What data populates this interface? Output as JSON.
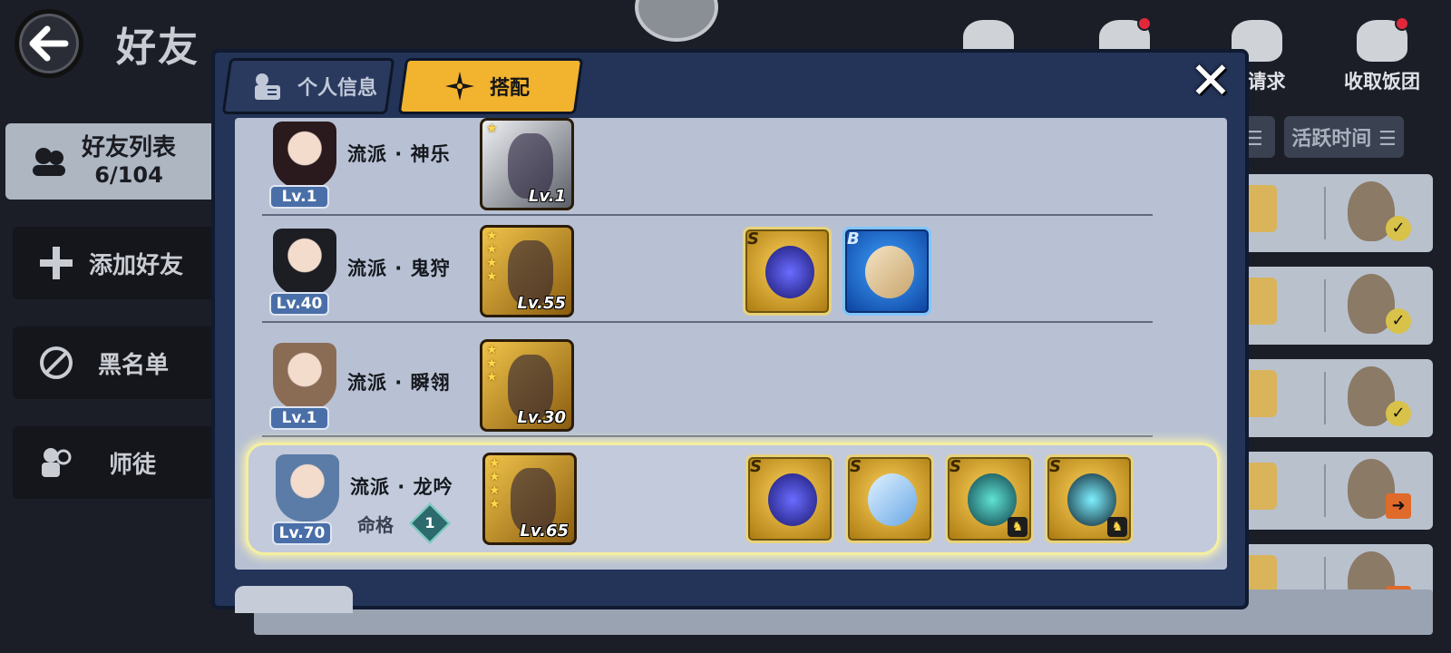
{
  "page": {
    "title": "好友",
    "back_icon": "back-arrow-icon"
  },
  "top_icons": [
    {
      "label": "",
      "icon": "group-icon",
      "has_dot": false
    },
    {
      "label": "",
      "icon": "friend-request-icon",
      "has_dot": true
    },
    {
      "label": "友请求",
      "icon": "soap-icon",
      "has_dot": false
    },
    {
      "label": "收取饭团",
      "icon": "rice-ball-icon",
      "has_dot": true
    }
  ],
  "sidebar": {
    "items": [
      {
        "label": "好友列表",
        "count": "6/104",
        "icon": "friends-icon",
        "active": true
      },
      {
        "label": "添加好友",
        "icon": "plus-icon",
        "active": false
      },
      {
        "label": "黑名单",
        "icon": "block-icon",
        "active": false
      },
      {
        "label": "师徒",
        "icon": "mentor-icon",
        "active": false
      }
    ]
  },
  "list_headers": [
    {
      "label": "度 ☰"
    },
    {
      "label": "活跃时间 ☰"
    }
  ],
  "right_rows": [
    {
      "status": "check"
    },
    {
      "status": "check"
    },
    {
      "status": "check"
    },
    {
      "status": "arrow"
    },
    {
      "status": "arrow"
    }
  ],
  "modal": {
    "tabs": [
      {
        "label": "个人信息",
        "icon": "profile-card-icon",
        "active": false
      },
      {
        "label": "搭配",
        "icon": "shuriken-icon",
        "active": true
      }
    ],
    "close_label": "✕",
    "rows": [
      {
        "style": "流派 · 神乐",
        "level": "Lv.1",
        "mingge": "",
        "portrait_color": "#2a1a1e",
        "weapon": {
          "level": "Lv.1",
          "stars": 1,
          "theme": "silver"
        },
        "equips": []
      },
      {
        "style": "流派 · 鬼狩",
        "level": "Lv.40",
        "mingge": "",
        "portrait_color": "#1d1d24",
        "weapon": {
          "level": "Lv.55",
          "stars": 4,
          "theme": "gold"
        },
        "equips": [
          {
            "grade": "S",
            "theme": "gold",
            "core": "orb"
          },
          {
            "grade": "B",
            "theme": "blue",
            "core": "scroll"
          }
        ]
      },
      {
        "style": "流派 · 瞬翎",
        "level": "Lv.1",
        "mingge": "",
        "portrait_color": "#8a6c55",
        "weapon": {
          "level": "Lv.30",
          "stars": 3,
          "theme": "gold"
        },
        "equips": []
      },
      {
        "style": "流派 · 龙吟",
        "level": "Lv.70",
        "mingge": "命格",
        "mingge_value": "1",
        "portrait_color": "#5b7ca6",
        "weapon": {
          "level": "Lv.65",
          "stars": 4,
          "theme": "gold"
        },
        "equips": [
          {
            "grade": "S",
            "theme": "gold",
            "core": "orb"
          },
          {
            "grade": "S",
            "theme": "gold",
            "core": "crystal"
          },
          {
            "grade": "S",
            "theme": "gold",
            "core": "ring"
          },
          {
            "grade": "S",
            "theme": "gold",
            "core": "shuriken"
          }
        ]
      }
    ]
  },
  "colors": {
    "background": "#1b1e27",
    "modal_bg": "#233458",
    "active_tab": "#f2b32e",
    "panel": "#b8c1d3",
    "highlight": "#f4efa0",
    "level_pill": "#4a6fa8"
  }
}
